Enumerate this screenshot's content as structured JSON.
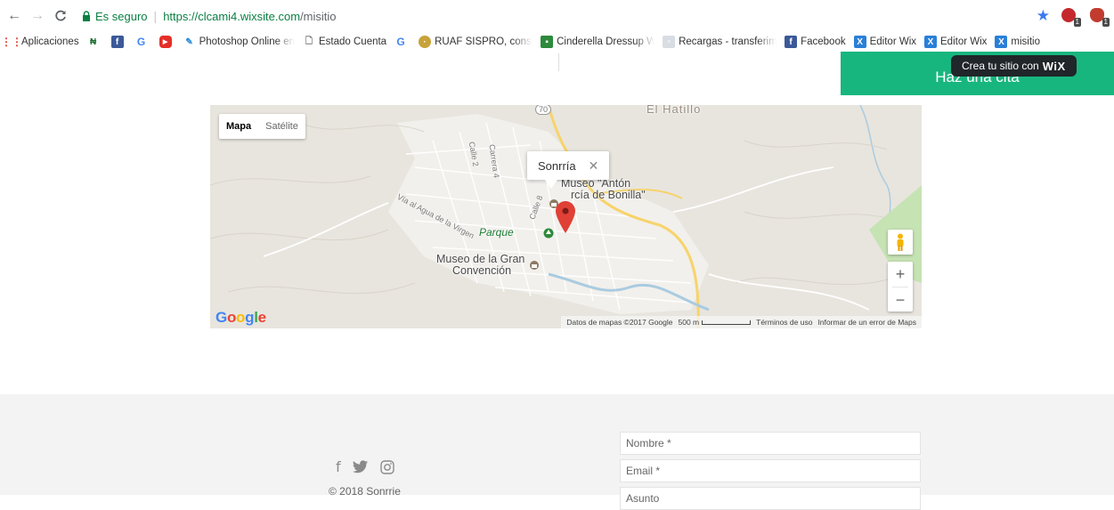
{
  "browser": {
    "security_label": "Es seguro",
    "url_host": "https://clcami4.wixsite.com",
    "url_path": "/misitio",
    "ext_badge_1": "1",
    "ext_badge_2": "1"
  },
  "bookmarks": {
    "apps_label": "Aplicaciones",
    "items": [
      {
        "label": "Photoshop Online en"
      },
      {
        "label": "Estado Cuenta"
      },
      {
        "label": "RUAF SISPRO, consul"
      },
      {
        "label": "Cinderella Dressup W"
      },
      {
        "label": "Recargas - transferim"
      },
      {
        "label": "Facebook"
      },
      {
        "label": "Editor Wix"
      },
      {
        "label": "Editor Wix"
      },
      {
        "label": "misitio"
      }
    ]
  },
  "page": {
    "cta_label": "Haz una cita",
    "wix_tip_prefix": "Crea tu sitio con",
    "wix_tip_brand": "WiX"
  },
  "map": {
    "type_map": "Mapa",
    "type_satellite": "Satélite",
    "infowindow_title": "Sonrría",
    "infowindow_close": "✕",
    "labels": {
      "museo_anton_1": "Museo \"Antón",
      "museo_anton_2": "rcía de Bonilla\"",
      "parque": "Parque",
      "museo_gran_1": "Museo de la Gran",
      "museo_gran_2": "Convención",
      "el_hatillo": "El Hatillo",
      "road_70": "70",
      "calle_2": "Calle 2",
      "carrera_4": "Carrera 4",
      "calle_8": "Calle 8",
      "via_agua": "Vía al Agua de la Virgen"
    },
    "zoom_in": "+",
    "zoom_out": "−",
    "google_logo": "Google",
    "attribution": "Datos de mapas ©2017 Google",
    "scale": "500 m",
    "terms": "Términos de uso",
    "report": "Informar de un error de Maps"
  },
  "footer": {
    "copyright": "© 2018 Sonrrie",
    "name_placeholder": "Nombre *",
    "email_placeholder": "Email *",
    "subject_placeholder": "Asunto"
  },
  "colors": {
    "cta": "#18b67f",
    "secure": "#0b8043",
    "marker": "#e04036"
  }
}
